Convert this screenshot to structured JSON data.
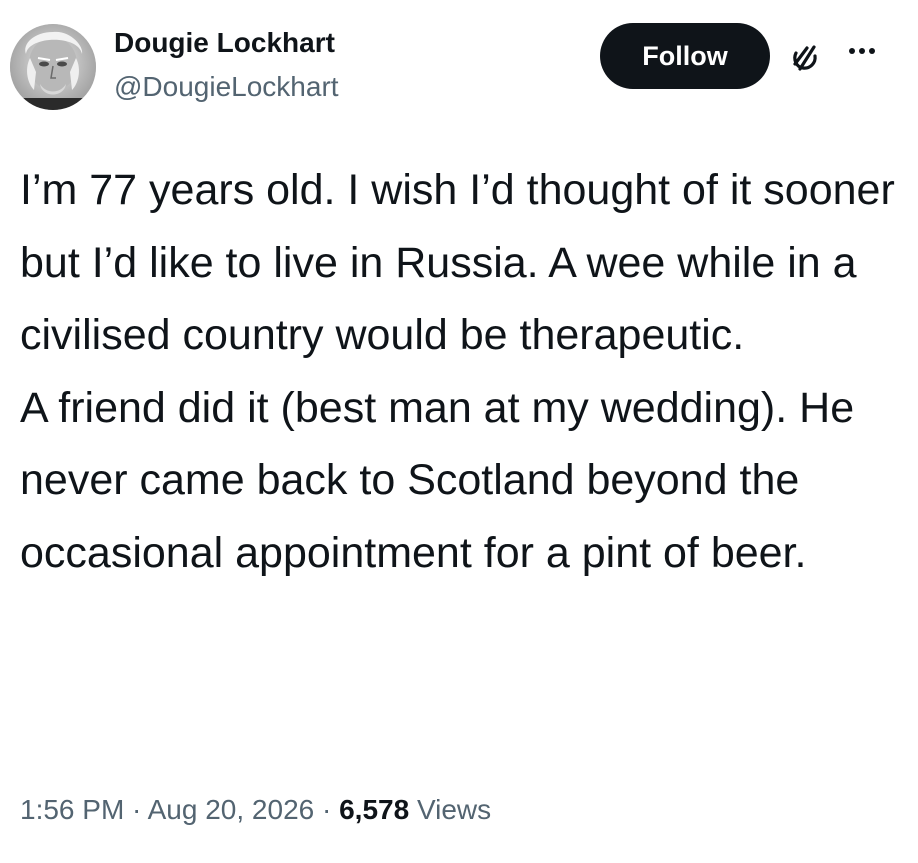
{
  "author": {
    "display_name": "Dougie Lockhart",
    "handle": "@DougieLockhart",
    "avatar_icon": "profile-photo"
  },
  "actions": {
    "follow_label": "Follow",
    "grok_icon": "grok-icon",
    "more_icon": "more-icon"
  },
  "tweet": {
    "text": "I’m 77 years old.  I wish I’d thought of it sooner but I’d like to live in Russia.  A wee while in a civilised country would be therapeutic.\nA friend did it (best man at my wedding).  He never came back to Scotland beyond the occasional appointment for a pint of beer."
  },
  "meta": {
    "time": "1:56 PM",
    "separator": " · ",
    "date": "Aug 20, 2026",
    "views_count": "6,578",
    "views_label": " Views"
  },
  "colors": {
    "text_primary": "#0f1419",
    "text_secondary": "#536471",
    "button_bg": "#0f1419",
    "button_text": "#ffffff",
    "background": "#ffffff"
  }
}
